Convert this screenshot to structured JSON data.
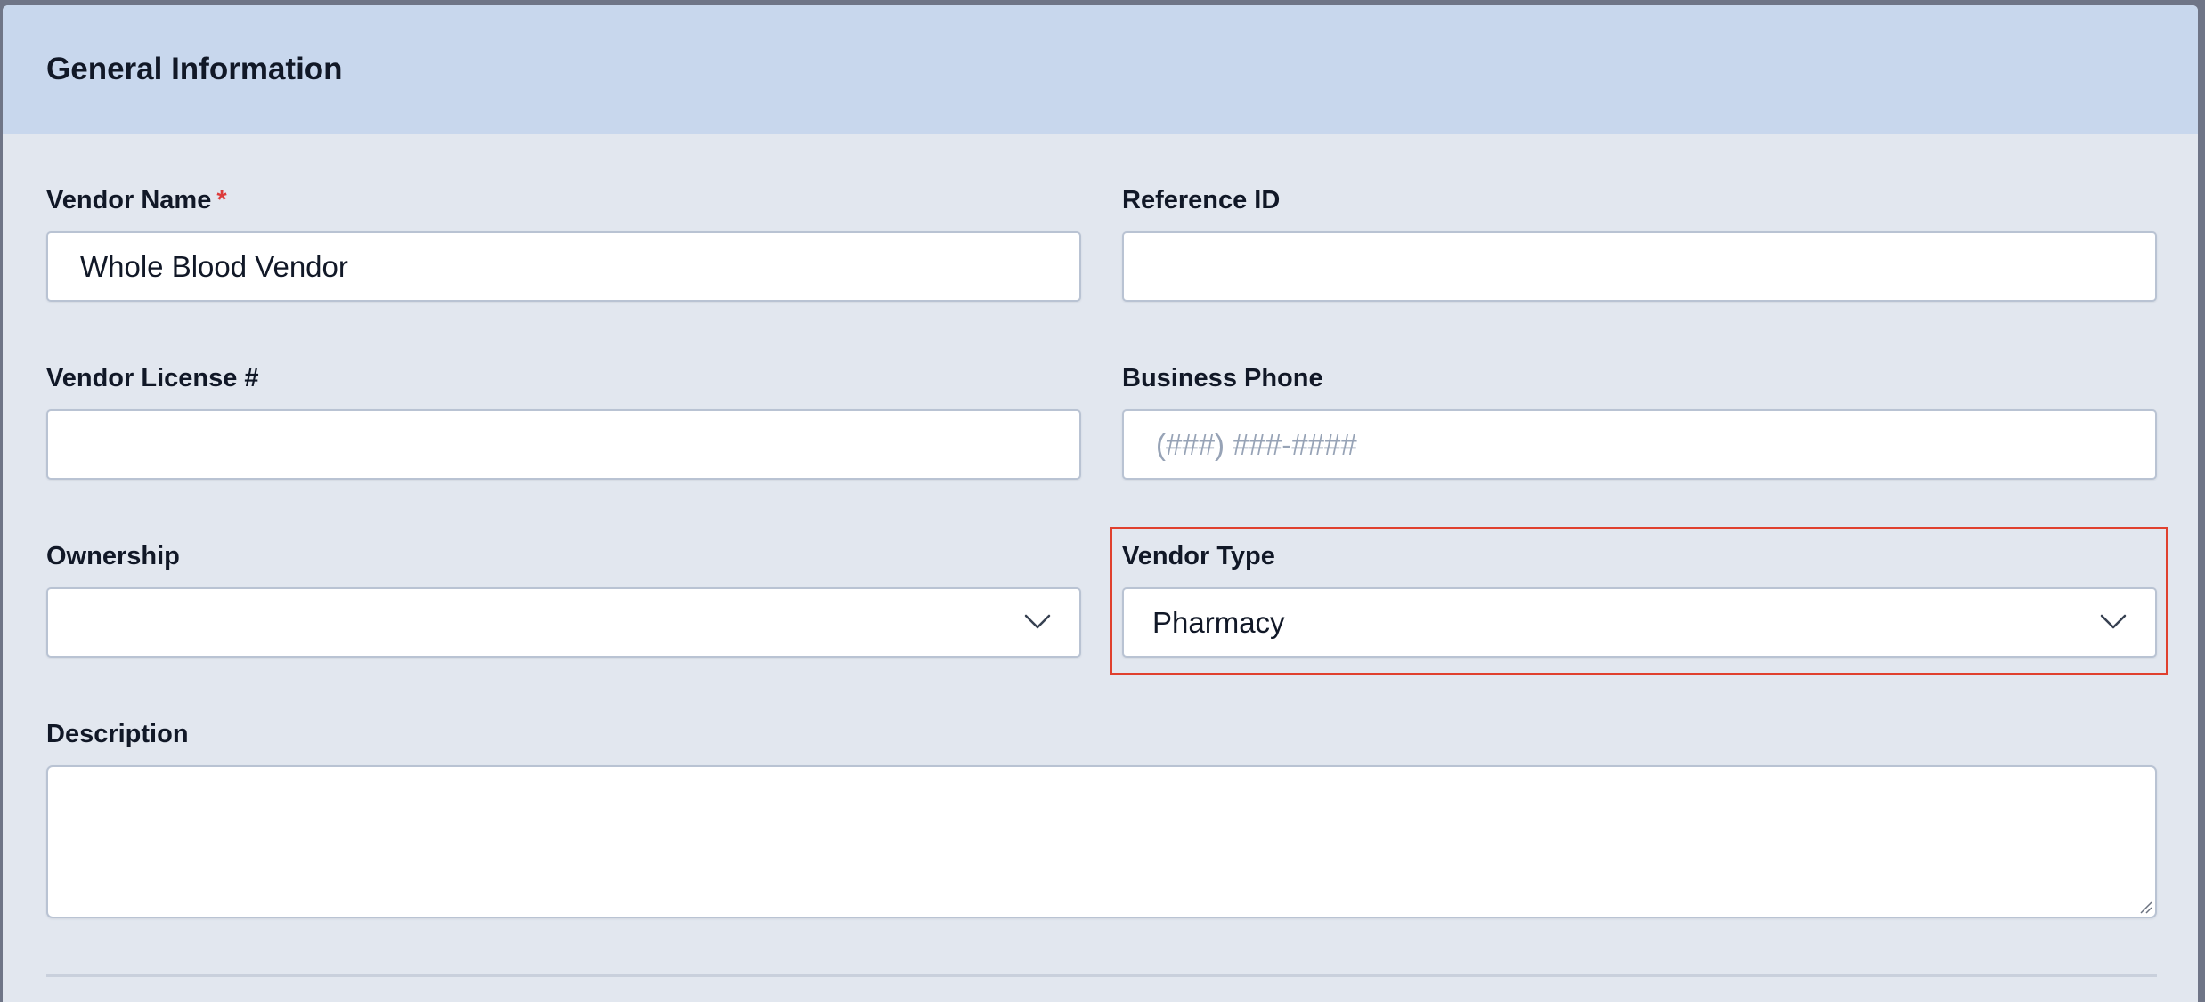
{
  "section": {
    "title": "General Information"
  },
  "fields": {
    "vendor_name": {
      "label": "Vendor Name",
      "required_marker": "*",
      "value": "Whole Blood Vendor"
    },
    "reference_id": {
      "label": "Reference ID",
      "value": ""
    },
    "vendor_license": {
      "label": "Vendor License #",
      "value": ""
    },
    "business_phone": {
      "label": "Business Phone",
      "value": "",
      "placeholder": "(###) ###-####"
    },
    "ownership": {
      "label": "Ownership",
      "selected": "",
      "icon": "chevron-down-icon"
    },
    "vendor_type": {
      "label": "Vendor Type",
      "selected": "Pharmacy",
      "icon": "chevron-down-icon"
    },
    "description": {
      "label": "Description",
      "value": ""
    }
  },
  "colors": {
    "header_bg": "#c8d7ed",
    "panel_bg": "#e2e7ef",
    "required": "#dc3b3b",
    "highlight": "#e0402e",
    "placeholder": "#97a3b6"
  }
}
